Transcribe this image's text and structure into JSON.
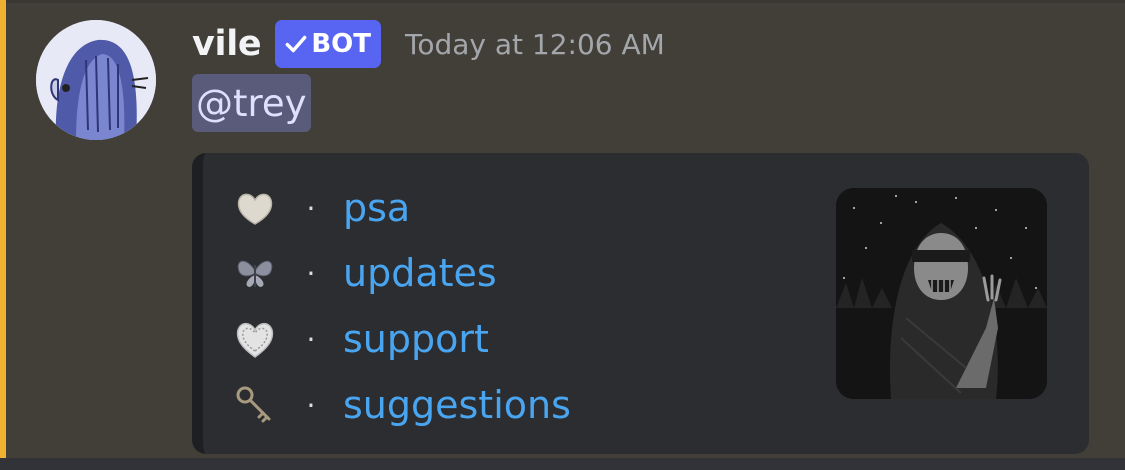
{
  "message": {
    "author": "vile",
    "bot_label": "BOT",
    "timestamp": "Today at 12:06 AM",
    "mention": "@trey",
    "avatar_icon": "avatar-anime-girl-icon",
    "colors": {
      "background": "#413f38",
      "mention_bar": "#f0b132",
      "bot_badge": "#5865f2",
      "link": "#4aa5f0",
      "embed": "#2b2d31"
    }
  },
  "embed": {
    "separator": "·",
    "items": [
      {
        "icon": "heart-pillow-icon",
        "label": "psa"
      },
      {
        "icon": "butterfly-icon",
        "label": "updates"
      },
      {
        "icon": "lace-heart-icon",
        "label": "support"
      },
      {
        "icon": "key-icon",
        "label": "suggestions"
      }
    ],
    "thumbnail_icon": "grim-reaper-image"
  }
}
